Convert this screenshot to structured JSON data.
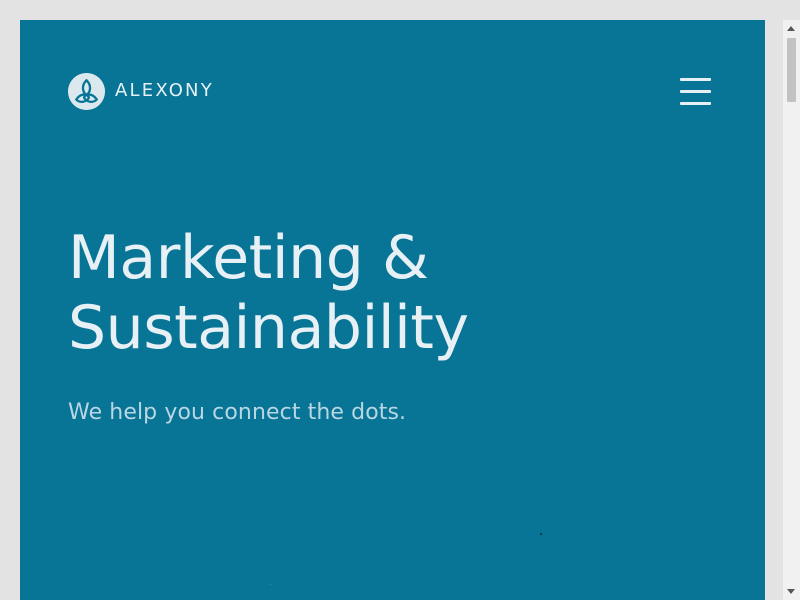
{
  "brand": {
    "name": "ALEXONY",
    "logo_icon": "trinity-knot-icon"
  },
  "navigation": {
    "menu_icon": "hamburger-menu-icon"
  },
  "hero": {
    "headline_line_1": "Marketing &",
    "headline_line_2": "Sustainability",
    "tagline": "We help you connect the dots."
  },
  "colors": {
    "background": "#087496",
    "primary_text": "#E7F1F5",
    "secondary_text": "#B9D7E2",
    "page_background": "#E3E3E3"
  }
}
